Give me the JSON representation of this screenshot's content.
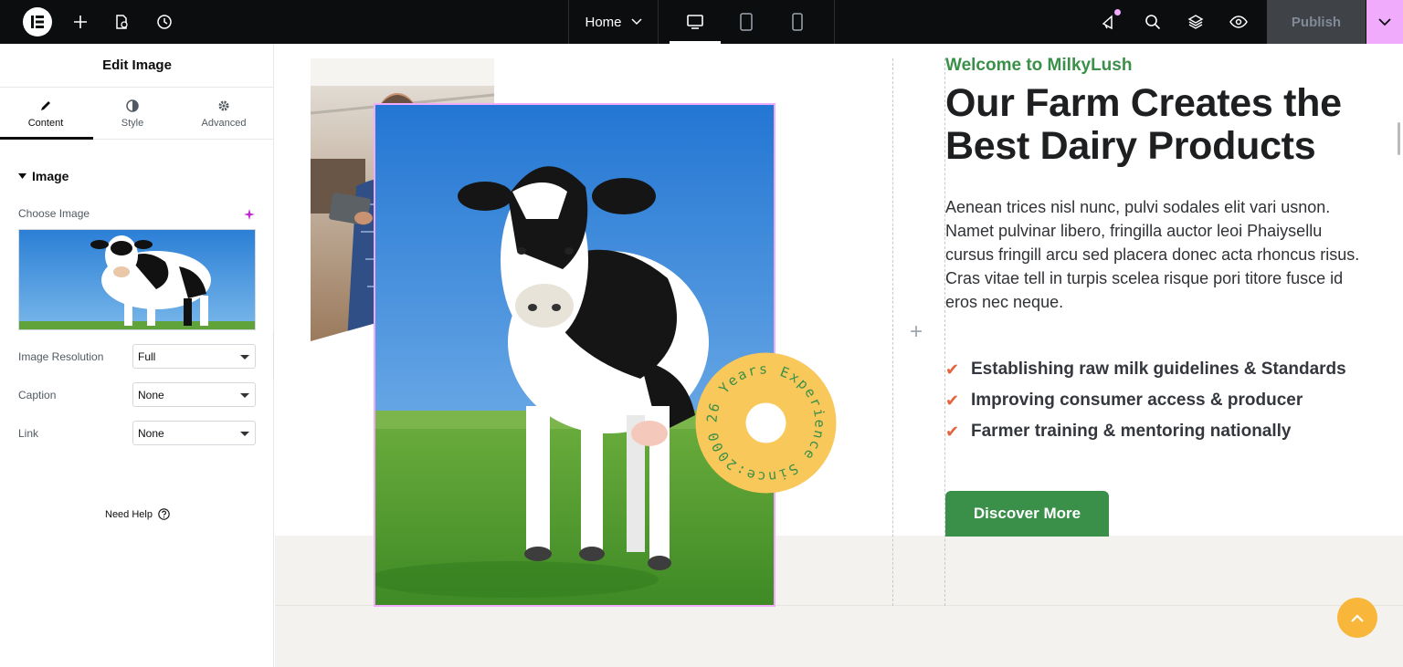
{
  "topbar": {
    "page_name": "Home",
    "publish_label": "Publish",
    "icons": [
      "elementor-logo-icon",
      "add-element-icon",
      "page-settings-icon",
      "history-icon",
      "desktop-icon",
      "tablet-icon",
      "mobile-icon",
      "whats-new-icon",
      "search-icon",
      "structure-icon",
      "preview-icon"
    ]
  },
  "panel": {
    "title": "Edit Image",
    "tabs": [
      {
        "label": "Content",
        "icon": "pencil-icon",
        "active": true
      },
      {
        "label": "Style",
        "icon": "half-circle-icon",
        "active": false
      },
      {
        "label": "Advanced",
        "icon": "gear-icon",
        "active": false
      }
    ],
    "section_title": "Image",
    "choose_image_label": "Choose Image",
    "controls": [
      {
        "label": "Image Resolution",
        "value": "Full"
      },
      {
        "label": "Caption",
        "value": "None"
      },
      {
        "label": "Link",
        "value": "None"
      }
    ],
    "need_help": "Need Help"
  },
  "canvas": {
    "welcome": "Welcome to MilkyLush",
    "heading_line1": "Our Farm Creates the",
    "heading_line2": "Best Dairy Products",
    "paragraph": "Aenean trices nisl nunc, pulvi sodales elit vari usnon. Namet pulvinar libero, fringilla auctor leoi Phaiysellu cursus fringill arcu sed placera donec acta rhoncus risus. Cras vitae tell in turpis scelea risque pori titore fusce id eros nec neque.",
    "checklist": [
      "Establishing raw milk guidelines & Standards",
      "Improving consumer access & producer",
      "Farmer training & mentoring nationally"
    ],
    "button": "Discover More",
    "badge_text": "26 Years Experience Since:2000"
  },
  "colors": {
    "brand_green": "#3a8f49",
    "accent_orange": "#e5633d",
    "badge_yellow": "#f8c85a",
    "selection_pink": "#f0abfc",
    "topbar_bg": "#0c0d0e"
  }
}
